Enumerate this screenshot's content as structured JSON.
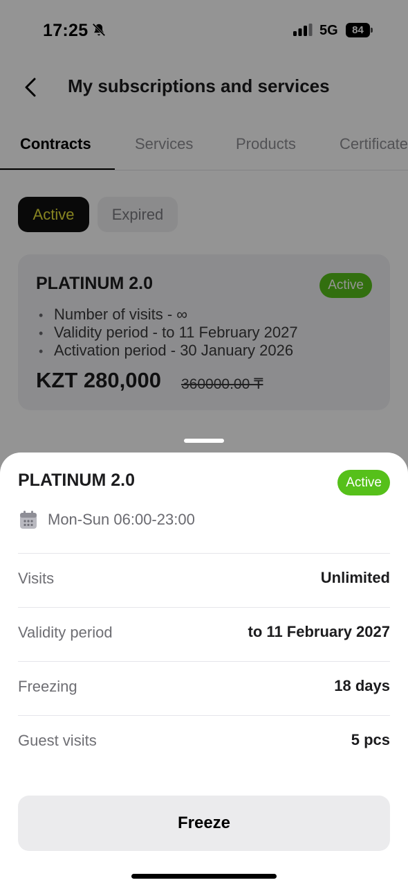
{
  "status_bar": {
    "time": "17:25",
    "network": "5G",
    "battery": "84"
  },
  "header": {
    "title": "My subscriptions and services"
  },
  "tabs": [
    {
      "label": "Contracts",
      "active": true
    },
    {
      "label": "Services"
    },
    {
      "label": "Products"
    },
    {
      "label": "Certificates"
    }
  ],
  "filters": {
    "active": "Active",
    "expired": "Expired"
  },
  "card": {
    "title": "PLATINUM 2.0",
    "badge": "Active",
    "details": [
      "Number of visits - ∞",
      "Validity period - to 11 February 2027",
      "Activation period - 30 January 2026"
    ],
    "price": "KZT 280,000",
    "old_price": "360000.00 ₸"
  },
  "sheet": {
    "title": "PLATINUM 2.0",
    "badge": "Active",
    "schedule": "Mon-Sun 06:00-23:00",
    "rows": [
      {
        "label": "Visits",
        "value": "Unlimited"
      },
      {
        "label": "Validity period",
        "value": "to 11 February 2027"
      },
      {
        "label": "Freezing",
        "value": "18 days"
      },
      {
        "label": "Guest visits",
        "value": "5 pcs"
      }
    ],
    "button": "Freeze"
  },
  "colors": {
    "accent_green": "#56c01a",
    "chip_text_yellow": "#e8e339"
  },
  "icons": [
    "bell-slash-icon",
    "signal-icon",
    "battery-icon",
    "back-chevron-icon",
    "calendar-icon"
  ]
}
